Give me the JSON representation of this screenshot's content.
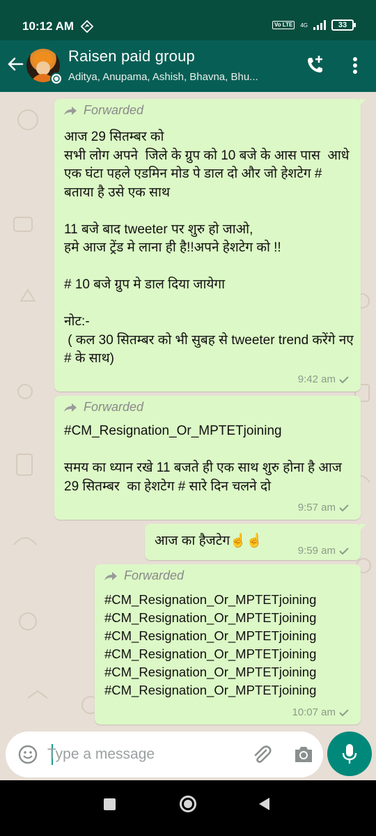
{
  "status_bar": {
    "time": "10:12 AM",
    "lte": "Vo LTE",
    "network": "4G",
    "battery": "33"
  },
  "header": {
    "title": "Raisen paid group",
    "members": "Aditya, Anupama, Ashish, Bhavna, Bhu..."
  },
  "messages": [
    {
      "forwarded_label": "Forwarded",
      "text": "आज 29 सितम्बर को \nसभी लोग अपने  जिले के ग्रुप को 10 बजे के आस पास  आधे एक घंटा पहले एडमिन मोड पे डाल दो और जो हेशटेग # बताया है उसे एक साथ \n\n11 बजे बाद tweeter पर शुरु हो जाओ,\nहमे आज ट्रेंड मे लाना ही है!!अपने हेशटेग को !!\n\n# 10 बजे ग्रुप मे डाल दिया जायेगा \n\nनोट:-\n ( कल 30 सितम्बर को भी सुबह से tweeter trend करेंगे नए # के साथ)",
      "time": "9:42 am"
    },
    {
      "forwarded_label": "Forwarded",
      "text": "#CM_Resignation_Or_MPTETjoining\n\nसमय का ध्यान रखे 11 बजते ही एक साथ शुरु होना है आज 29 सितम्बर  का हेशटेग # सारे दिन चलने दो",
      "time": "9:57 am"
    },
    {
      "text": "आज का हैजटेग☝️☝️",
      "time": "9:59 am"
    },
    {
      "forwarded_label": "Forwarded",
      "text": "#CM_Resignation_Or_MPTETjoining\n#CM_Resignation_Or_MPTETjoining\n#CM_Resignation_Or_MPTETjoining\n#CM_Resignation_Or_MPTETjoining\n#CM_Resignation_Or_MPTETjoining\n#CM_Resignation_Or_MPTETjoining",
      "time": "10:07 am"
    }
  ],
  "input": {
    "placeholder": "Type a message"
  },
  "colors": {
    "header": "#075e54",
    "status_bar": "#074e3f",
    "bubble_out": "#dcf8c6",
    "chat_bg": "#e7ded5",
    "accent": "#00897b"
  },
  "icons": [
    "back-arrow-icon",
    "group-avatar",
    "add-call-icon",
    "more-options-icon",
    "forwarded-icon",
    "read-ticks-icon",
    "emoji-icon",
    "attach-icon",
    "camera-icon",
    "mic-icon"
  ]
}
